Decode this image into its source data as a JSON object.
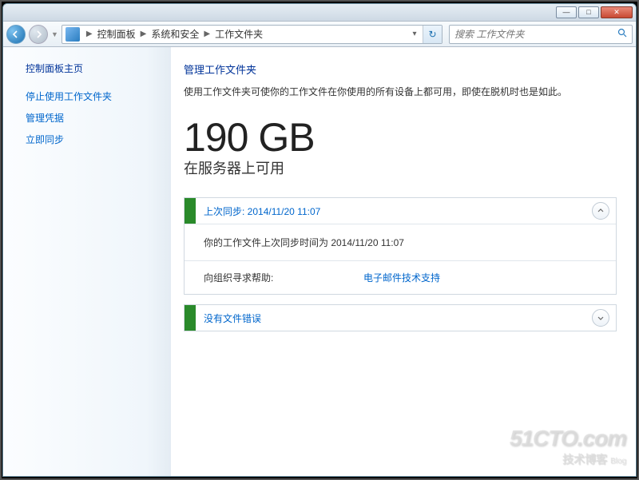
{
  "window": {
    "minimize": "—",
    "maximize": "□",
    "close": "✕"
  },
  "breadcrumb": {
    "items": [
      "控制面板",
      "系统和安全",
      "工作文件夹"
    ]
  },
  "search": {
    "placeholder": "搜索 工作文件夹"
  },
  "sidebar": {
    "home": "控制面板主页",
    "links": [
      "停止使用工作文件夹",
      "管理凭据",
      "立即同步"
    ]
  },
  "main": {
    "title": "管理工作文件夹",
    "desc": "使用工作文件夹可使你的工作文件在你使用的所有设备上都可用，即使在脱机时也是如此。",
    "quota_value": "190 GB",
    "quota_label": "在服务器上可用"
  },
  "sync_panel": {
    "header": "上次同步: 2014/11/20 11:07",
    "body": "你的工作文件上次同步时间为 2014/11/20 11:07",
    "help_label": "向组织寻求帮助:",
    "help_link": "电子邮件技术支持"
  },
  "error_panel": {
    "header": "没有文件错误"
  },
  "watermark": {
    "line1": "51CTO.com",
    "line2": "技术博客",
    "line2_small": "Blog"
  }
}
